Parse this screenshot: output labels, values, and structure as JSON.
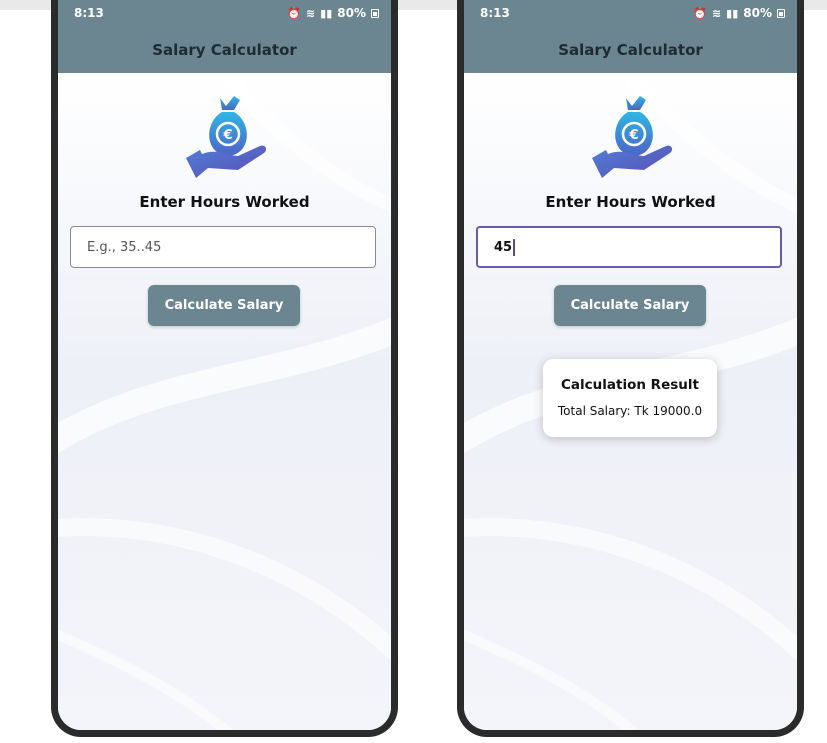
{
  "status_bar": {
    "time": "8:13",
    "battery": "80%"
  },
  "app": {
    "title": "Salary Calculator"
  },
  "screens": [
    {
      "heading": "Enter Hours Worked",
      "input": {
        "placeholder": "E.g., 35..45",
        "value": ""
      },
      "button_label": "Calculate Salary"
    },
    {
      "heading": "Enter Hours Worked",
      "input": {
        "placeholder": "E.g., 35..45",
        "value": "45"
      },
      "button_label": "Calculate Salary",
      "result": {
        "title": "Calculation Result",
        "text": "Total Salary: Tk 19000.0"
      }
    }
  ],
  "colors": {
    "app_bar": "#6b8690",
    "button": "#6b8690",
    "focus_border": "#6b5aa6",
    "frame": "#2b2b2b"
  },
  "icons": [
    "money-bag-hand-icon",
    "alarm-icon",
    "wifi-icon",
    "signal-icon",
    "battery-icon"
  ]
}
